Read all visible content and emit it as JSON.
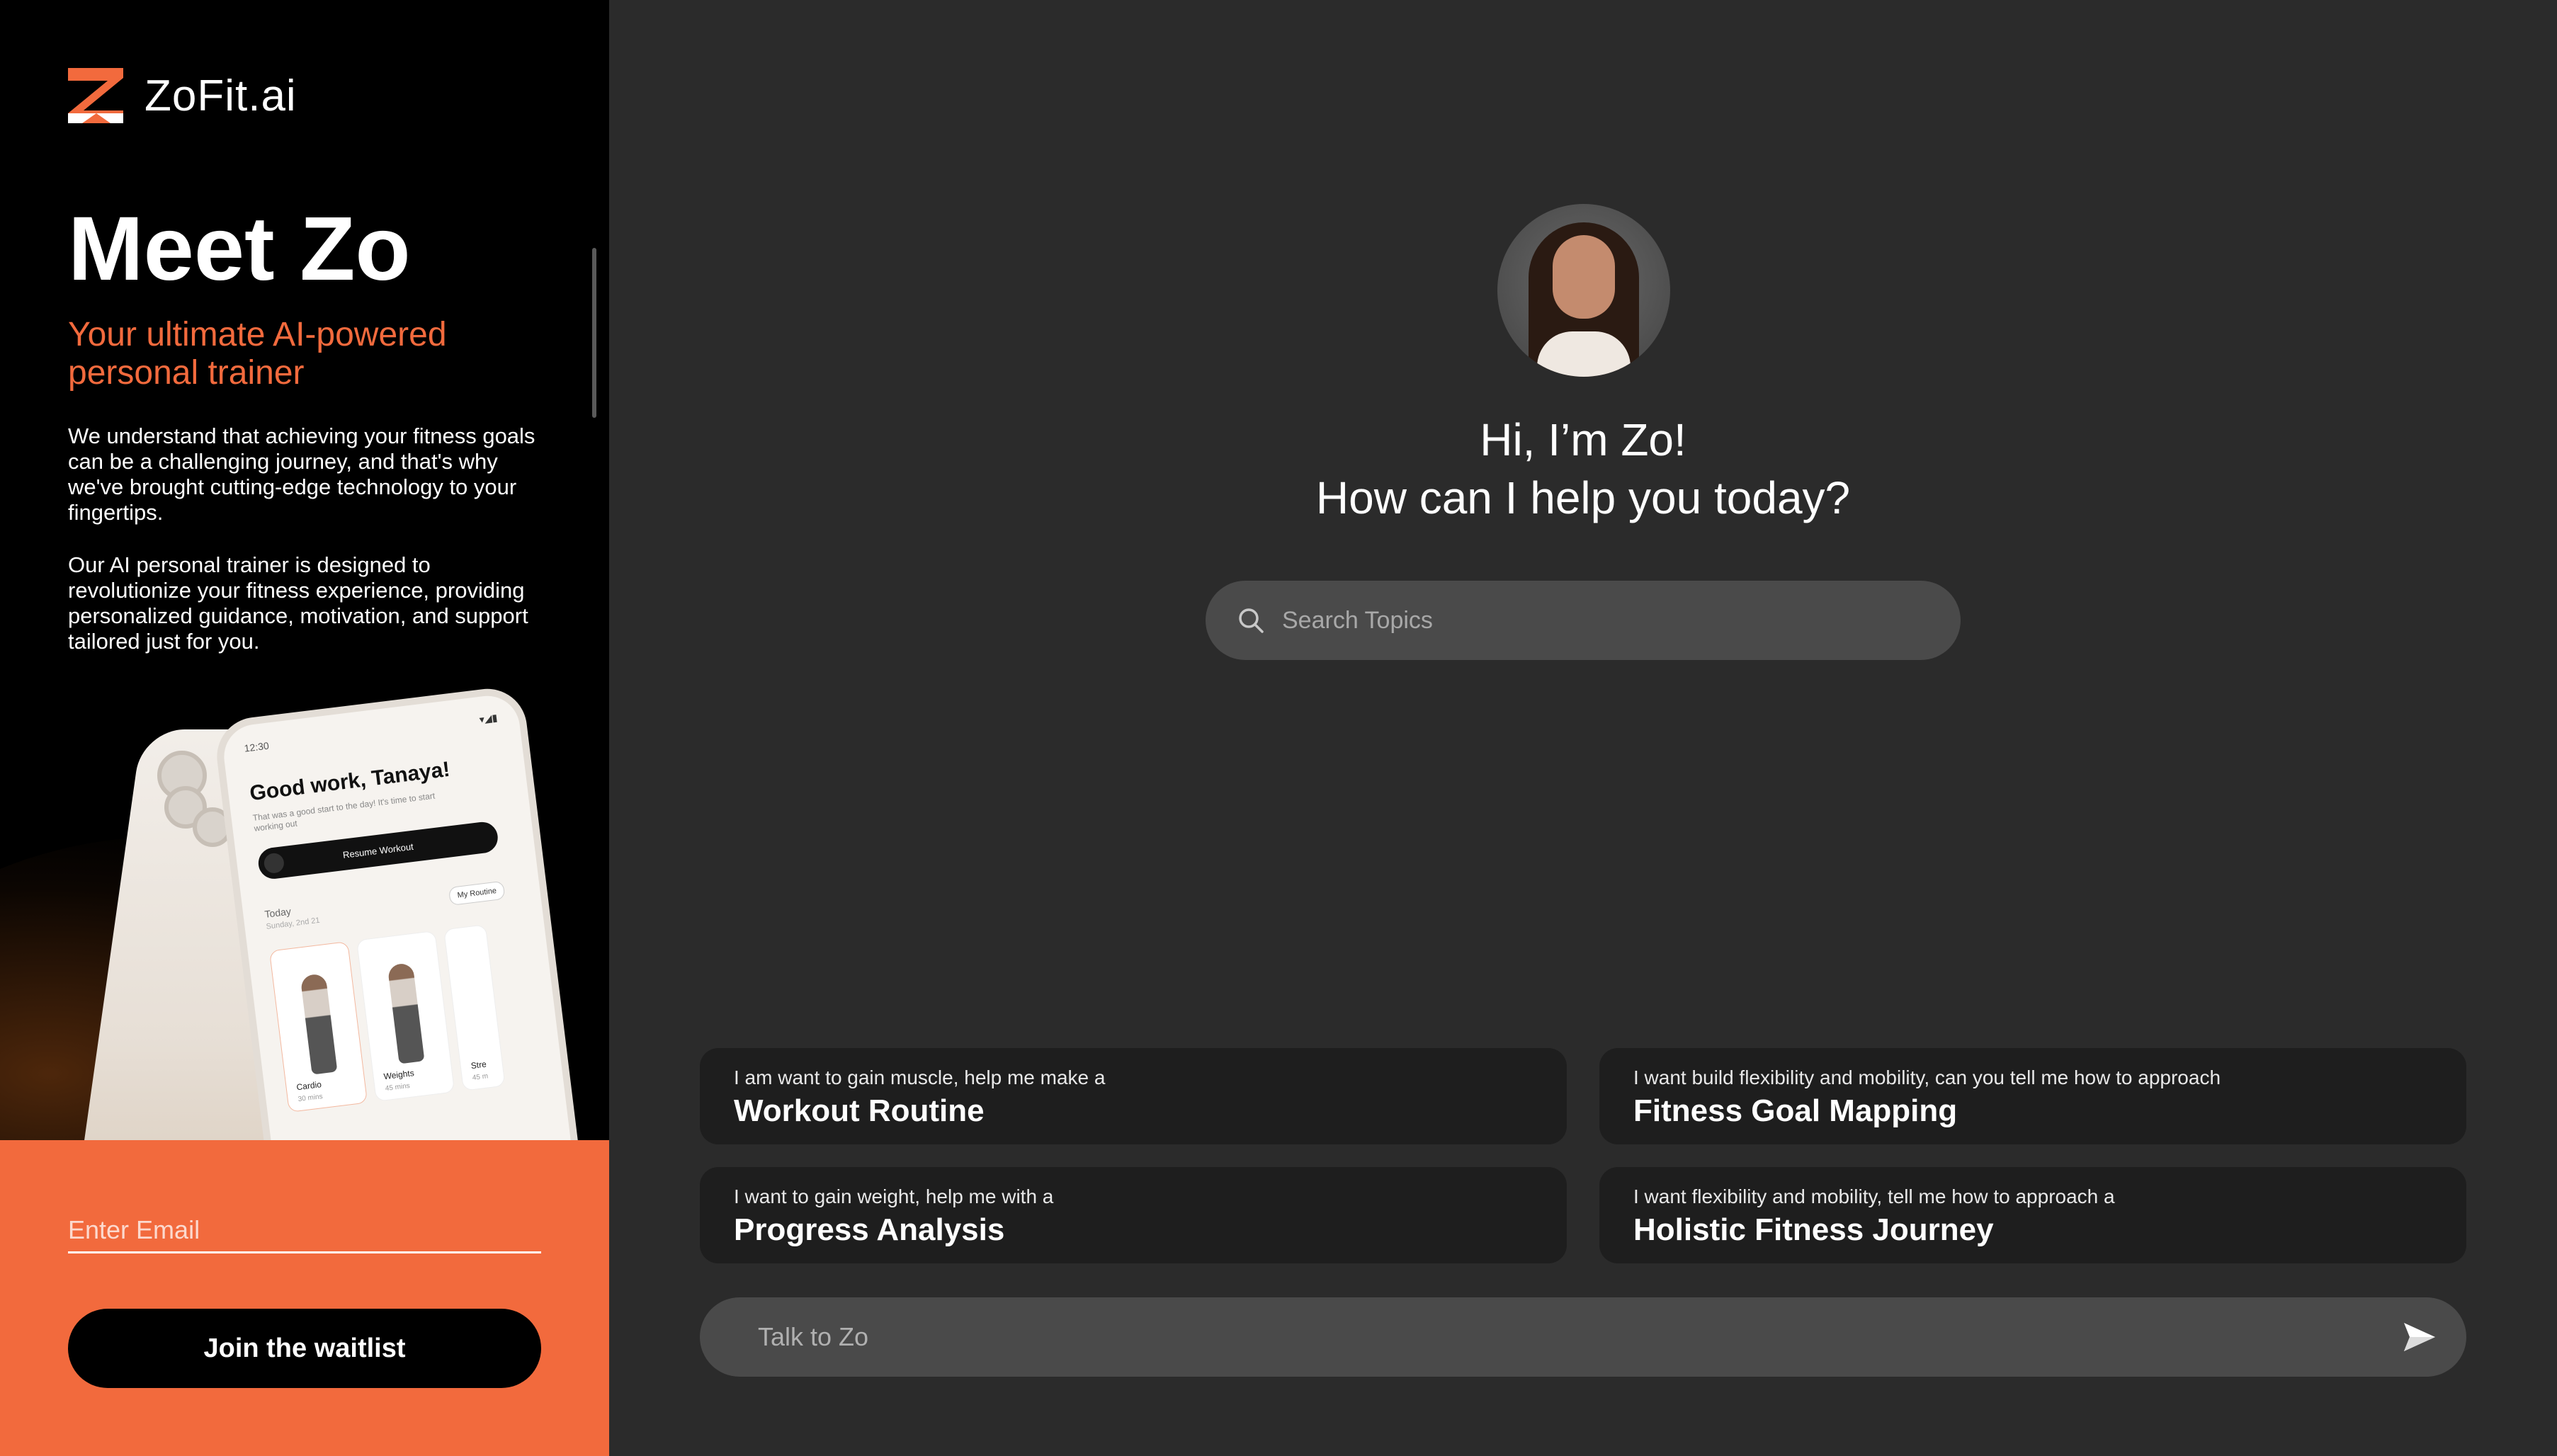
{
  "brand": {
    "name": "ZoFit.ai",
    "accent": "#f26a3d"
  },
  "hero": {
    "title": "Meet Zo",
    "subtitle": "Your ultimate AI-powered personal trainer",
    "paragraph1": "We understand that achieving your fitness goals can be a challenging journey, and that's why we've brought cutting-edge technology to your fingertips.",
    "paragraph2": "Our AI personal trainer is designed to revolutionize your fitness experience, providing personalized guidance, motivation, and support tailored just for you."
  },
  "phone": {
    "time": "12:30",
    "status": "▾◢▮",
    "greeting": "Good work, Tanaya!",
    "subtext": "That was a good start to the day! It's time to start working out",
    "resume_label": "Resume Workout",
    "today_label": "Today",
    "date_label": "Sunday, 2nd 21",
    "routine_label": "My Routine",
    "cards": [
      {
        "label": "Cardio",
        "duration": "30 mins"
      },
      {
        "label": "Weights",
        "duration": "45 mins"
      },
      {
        "label": "Stre",
        "duration": "45 m"
      }
    ]
  },
  "signup": {
    "email_placeholder": "Enter Email",
    "button_label": "Join the waitlist"
  },
  "assistant": {
    "greeting_line1": "Hi, I’m Zo!",
    "greeting_line2": "How can I help you today?"
  },
  "search": {
    "placeholder": "Search Topics",
    "icon": "search-icon"
  },
  "suggestions": [
    {
      "prefix": "I am want to gain muscle, help me make a",
      "title": "Workout Routine"
    },
    {
      "prefix": "I want build flexibility and mobility, can you tell me how to approach",
      "title": "Fitness Goal Mapping"
    },
    {
      "prefix": "I want to gain weight, help me with a",
      "title": "Progress Analysis"
    },
    {
      "prefix": "I want flexibility and mobility, tell me how to approach a",
      "title": "Holistic Fitness Journey"
    }
  ],
  "chat": {
    "placeholder": "Talk to Zo",
    "send_icon": "send-icon"
  }
}
